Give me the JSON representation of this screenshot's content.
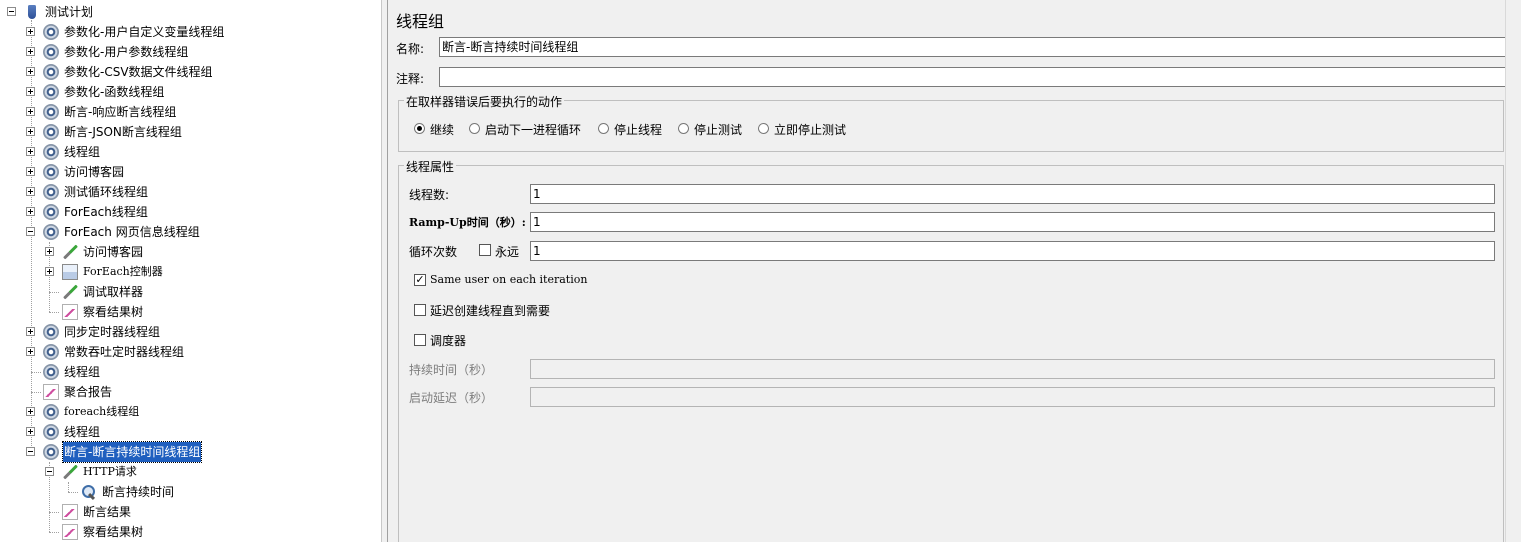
{
  "tree": {
    "root": "测试计划",
    "items": [
      {
        "label": "参数化-用户自定义变量线程组"
      },
      {
        "label": "参数化-用户参数线程组"
      },
      {
        "label": "参数化-CSV数据文件线程组"
      },
      {
        "label": "参数化-函数线程组"
      },
      {
        "label": "断言-响应断言线程组"
      },
      {
        "label": "断言-JSON断言线程组"
      },
      {
        "label": "线程组"
      },
      {
        "label": "访问博客园"
      },
      {
        "label": "测试循环线程组"
      },
      {
        "label": "ForEach线程组"
      },
      {
        "label": "ForEach 网页信息线程组"
      },
      {
        "label": "访问博客园"
      },
      {
        "label": "ForEach控制器"
      },
      {
        "label": "调试取样器"
      },
      {
        "label": "察看结果树"
      },
      {
        "label": "同步定时器线程组"
      },
      {
        "label": "常数吞吐定时器线程组"
      },
      {
        "label": "线程组"
      },
      {
        "label": "聚合报告"
      },
      {
        "label": "foreach线程组"
      },
      {
        "label": "线程组"
      },
      {
        "label": "断言-断言持续时间线程组"
      },
      {
        "label": "HTTP请求"
      },
      {
        "label": "断言持续时间"
      },
      {
        "label": "断言结果"
      },
      {
        "label": "察看结果树"
      }
    ]
  },
  "panel": {
    "title": "线程组",
    "name_label": "名称:",
    "name_value": "断言-断言持续时间线程组",
    "comment_label": "注释:",
    "comment_value": "",
    "error_action": {
      "legend": "在取样器错误后要执行的动作",
      "options": [
        "继续",
        "启动下一进程循环",
        "停止线程",
        "停止测试",
        "立即停止测试"
      ],
      "selected": "继续"
    },
    "thread_props": {
      "legend": "线程属性",
      "threads_label": "线程数:",
      "threads_value": "1",
      "rampup_label": "Ramp-Up时间（秒）:",
      "rampup_value": "1",
      "loop_label": "循环次数",
      "forever_label": "永远",
      "forever_checked": false,
      "loop_value": "1",
      "same_user_label": "Same user on each iteration",
      "same_user_checked": true,
      "delay_label": "延迟创建线程直到需要",
      "delay_checked": false,
      "scheduler_label": "调度器",
      "scheduler_checked": false,
      "duration_label": "持续时间（秒）",
      "duration_value": "",
      "startup_delay_label": "启动延迟（秒）",
      "startup_delay_value": ""
    }
  }
}
